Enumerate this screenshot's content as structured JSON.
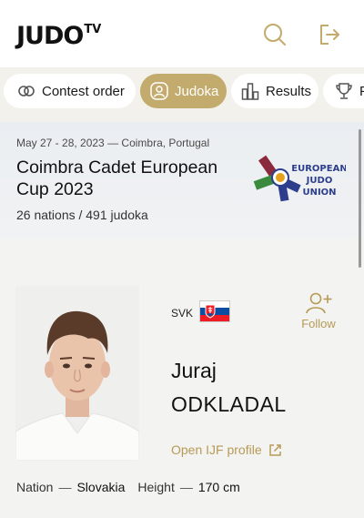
{
  "brand": {
    "logo_main": "JUDO",
    "logo_tv": "TV"
  },
  "header": {
    "search_icon": "search-icon",
    "logout_icon": "logout-icon"
  },
  "tabs": [
    {
      "label": "Contest order",
      "icon": "rings-icon",
      "active": false
    },
    {
      "label": "Judoka",
      "icon": "user-icon",
      "active": true
    },
    {
      "label": "Results",
      "icon": "bar-chart-icon",
      "active": false
    },
    {
      "label": "P",
      "icon": "trophy-icon",
      "active": false
    }
  ],
  "event": {
    "date": "May 27 - 28, 2023",
    "location": "Coimbra, Portugal",
    "title": "Coimbra Cadet European Cup 2023",
    "stats": "26 nations / 491 judoka",
    "org_logo": {
      "line1": "EUROPEAN",
      "line2": "JUDO",
      "line3": "UNION",
      "colors": [
        "#2c3e8c",
        "#3a8b3e",
        "#8b2a3c",
        "#e8a11c"
      ]
    }
  },
  "athlete": {
    "country_code": "SVK",
    "first_name": "Juraj",
    "last_name": "ODKLADAL",
    "follow_label": "Follow",
    "profile_link": "Open IJF profile",
    "nation_label": "Nation",
    "nation": "Slovakia",
    "height_label": "Height",
    "height": "170 cm"
  },
  "colors": {
    "accent_gold": "#c3aa6d",
    "link_gold": "#b79a55",
    "flag_white": "#ffffff",
    "flag_blue": "#0b4ea2",
    "flag_red": "#ee1c25"
  }
}
